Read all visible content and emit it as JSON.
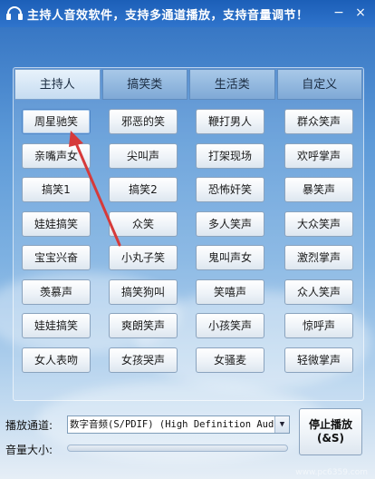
{
  "window": {
    "title": "主持人音效软件，支持多通道播放，支持音量调节！"
  },
  "tabs": [
    {
      "label": "主持人",
      "active": true
    },
    {
      "label": "搞笑类",
      "active": false
    },
    {
      "label": "生活类",
      "active": false
    },
    {
      "label": "自定义",
      "active": false
    }
  ],
  "sound_buttons": [
    [
      "周星驰笑",
      "邪恶的笑",
      "鞭打男人",
      "群众笑声"
    ],
    [
      "亲嘴声女",
      "尖叫声",
      "打架现场",
      "欢呼掌声"
    ],
    [
      "搞笑1",
      "搞笑2",
      "恐怖奸笑",
      "暴笑声"
    ],
    [
      "娃娃搞笑",
      "众笑",
      "多人笑声",
      "大众笑声"
    ],
    [
      "宝宝兴奋",
      "小丸子笑",
      "鬼叫声女",
      "激烈掌声"
    ],
    [
      "羡慕声",
      "搞笑狗叫",
      "笑嘻声",
      "众人笑声"
    ],
    [
      "娃娃搞笑",
      "爽朗笑声",
      "小孩笑声",
      "惊呼声"
    ],
    [
      "女人表吻",
      "女孩哭声",
      "女骚麦",
      "轻微掌声"
    ]
  ],
  "playback": {
    "channel_label": "播放通道:",
    "channel_value": "数字音频(S/PDIF) (High Definition Aud",
    "volume_label": "音量大小:",
    "stop_label_line1": "停止播放",
    "stop_label_line2": "(&S)"
  },
  "watermark": "www.pc6359.com",
  "colors": {
    "titlebar": "#2f74cc",
    "annotation_arrow": "#d63a3a"
  }
}
